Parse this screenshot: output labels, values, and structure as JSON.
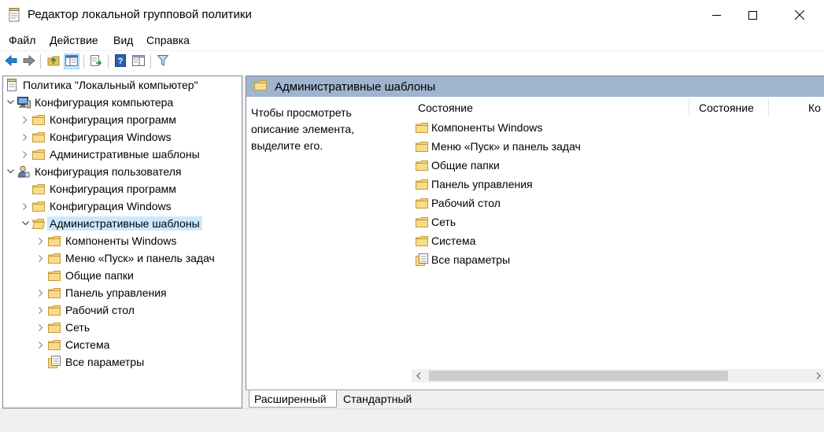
{
  "titlebar": {
    "title": "Редактор локальной групповой политики",
    "icon": "notepad-policy-icon",
    "controls": [
      "minimize-icon",
      "maximize-icon",
      "close-icon"
    ]
  },
  "menu": {
    "file": "Файл",
    "action": "Действие",
    "view": "Вид",
    "help": "Справка"
  },
  "toolbar": {
    "buttons": [
      "back-arrow-icon",
      "forward-arrow-icon",
      "up-folder-icon",
      "show-hide-tree-icon",
      "export-list-icon",
      "help-icon",
      "properties-pane-icon",
      "filter-icon"
    ]
  },
  "tree": {
    "root": "Политика \"Локальный компьютер\"",
    "computer_config": "Конфигурация компьютера",
    "cc_programs": "Конфигурация программ",
    "cc_windows": "Конфигурация Windows",
    "cc_admin_templates": "Административные шаблоны",
    "user_config": "Конфигурация пользователя",
    "uc_programs": "Конфигурация программ",
    "uc_windows": "Конфигурация Windows",
    "uc_admin_templates": "Административные шаблоны",
    "uc_at_children": [
      "Компоненты Windows",
      "Меню «Пуск» и панель задач",
      "Общие папки",
      "Панель управления",
      "Рабочий стол",
      "Сеть",
      "Система",
      "Все параметры"
    ]
  },
  "right": {
    "header": "Административные шаблоны",
    "description": "Чтобы просмотреть описание элемента, выделите его.",
    "desc_lines": [
      "Чтобы просмотреть",
      "описание элемента,",
      "выделите его."
    ],
    "columns": [
      "Состояние",
      "Состояние",
      "Ко"
    ],
    "items": [
      "Компоненты Windows",
      "Меню «Пуск» и панель задач",
      "Общие папки",
      "Панель управления",
      "Рабочий стол",
      "Сеть",
      "Система",
      "Все параметры"
    ]
  },
  "tabs": {
    "extended": "Расширенный",
    "standard": "Стандартный",
    "active": "Расширенный"
  },
  "colors": {
    "header_band": "#9fb5cf",
    "selection": "#cce8ff",
    "folder": "#e8c05a"
  }
}
